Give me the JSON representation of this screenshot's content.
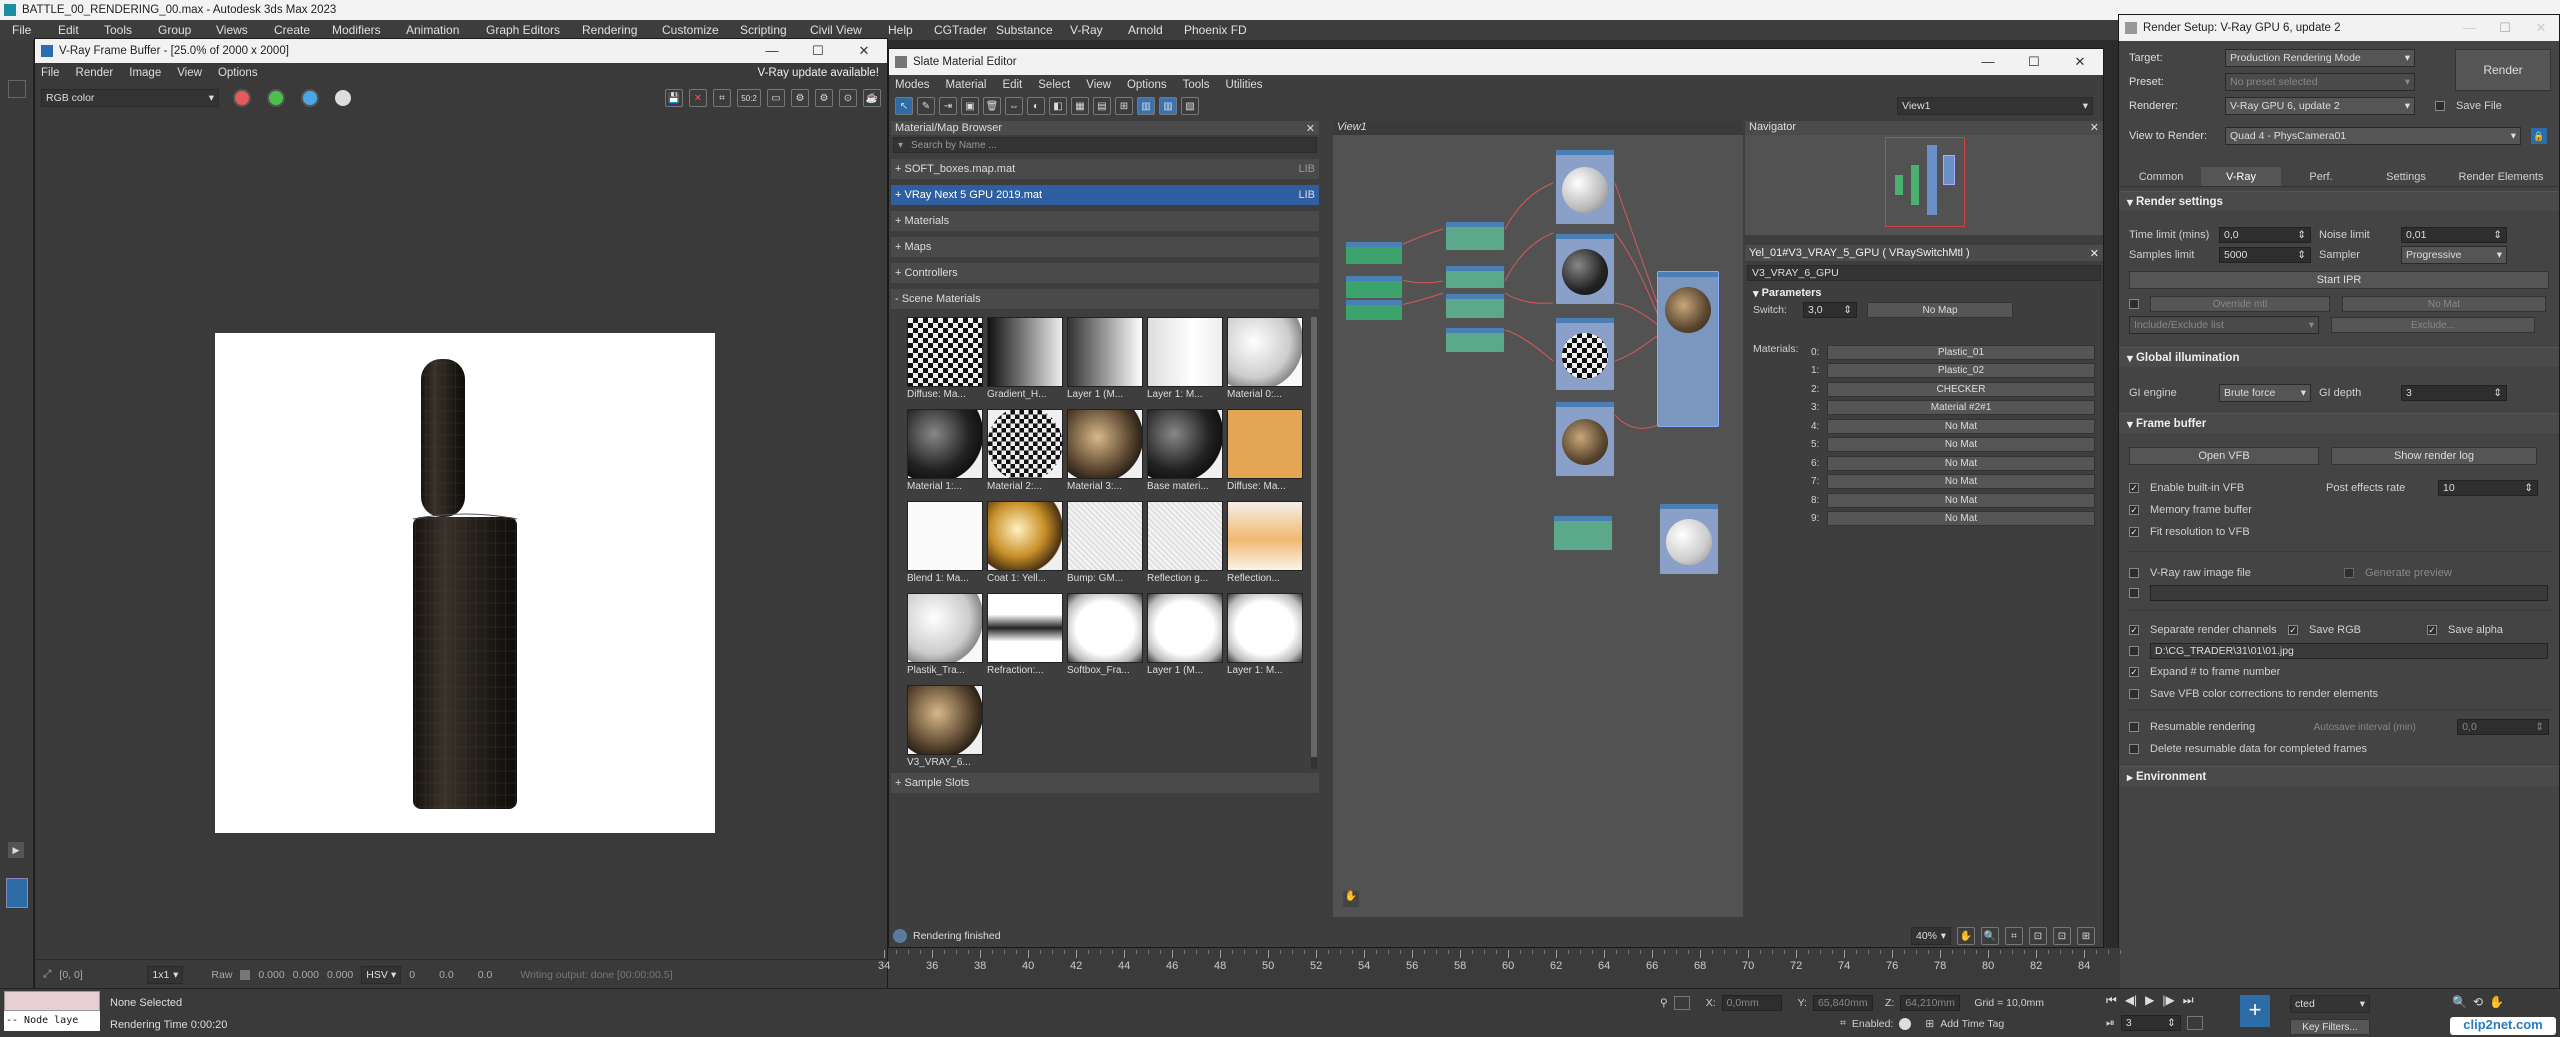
{
  "app": {
    "title": "BATTLE_00_RENDERING_00.max - Autodesk 3ds Max 2023",
    "menu": [
      "File",
      "Edit",
      "Tools",
      "Group",
      "Views",
      "Create",
      "Modifiers",
      "Animation",
      "Graph Editors",
      "Rendering",
      "Customize",
      "Scripting",
      "Civil View",
      "Help",
      "CGTrader",
      "Substance",
      "V-Ray",
      "Arnold",
      "Phoenix FD"
    ]
  },
  "vfb": {
    "title": "V-Ray Frame Buffer - [25.0% of 2000 x 2000]",
    "menu": [
      "File",
      "Render",
      "Image",
      "View",
      "Options"
    ],
    "update": "V-Ray update available!",
    "channel": "RGB color",
    "zoom_label": "50:2",
    "status": {
      "coords": "[0, 0]",
      "ratio": "1x1",
      "raw": "Raw",
      "v1": "0.000",
      "v2": "0.000",
      "v3": "0.000",
      "cs": "HSV",
      "n1": "0",
      "n2": "0.0",
      "n3": "0.0",
      "msg": "Writing output: done [00:00:00.5]"
    },
    "colors": {
      "red": "#e35b5b",
      "green": "#4cc24c",
      "blue": "#4aa8e8"
    }
  },
  "slate": {
    "title": "Slate Material Editor",
    "menu": [
      "Modes",
      "Material",
      "Edit",
      "Select",
      "View",
      "Options",
      "Tools",
      "Utilities"
    ],
    "view_dropdown": "View1",
    "browser_title": "Material/Map Browser",
    "search_placeholder": "Search by Name ...",
    "libs": [
      {
        "name": "+ SOFT_boxes.map.mat",
        "tag": "LIB",
        "active": false
      },
      {
        "name": "+ VRay Next 5 GPU 2019.mat",
        "tag": "LIB",
        "active": true
      }
    ],
    "groups": [
      "+ Materials",
      "+ Maps",
      "+ Controllers",
      "- Scene Materials"
    ],
    "swatches": [
      {
        "label": "Diffuse: Ma...",
        "style": "checker"
      },
      {
        "label": "Gradient_H...",
        "style": "gradh"
      },
      {
        "label": "Layer 1 (M...",
        "style": "gradh2"
      },
      {
        "label": "Layer 1: M...",
        "style": "gradv"
      },
      {
        "label": "Material 0:...",
        "style": "white_sphere"
      },
      {
        "label": "Material 1:...",
        "style": "dark_sphere"
      },
      {
        "label": "Material 2:...",
        "style": "checker_sphere"
      },
      {
        "label": "Material 3:...",
        "style": "brown_sphere"
      },
      {
        "label": "Base materi...",
        "style": "dark_sphere"
      },
      {
        "label": "Diffuse: Ma...",
        "style": "orange"
      },
      {
        "label": "Blend 1: Ma...",
        "style": "white"
      },
      {
        "label": "Coat 1: Yell...",
        "style": "gold_sphere"
      },
      {
        "label": "Bump: GM...",
        "style": "noise"
      },
      {
        "label": "Reflection g...",
        "style": "noise"
      },
      {
        "label": "Reflection...",
        "style": "orange_grad"
      },
      {
        "label": "Plastik_Tra...",
        "style": "white_sphere"
      },
      {
        "label": "Refraction:...",
        "style": "gradv2"
      },
      {
        "label": "Softbox_Fra...",
        "style": "softbox"
      },
      {
        "label": "Layer 1 (M...",
        "style": "softbox"
      },
      {
        "label": "Layer 1: M...",
        "style": "softbox"
      },
      {
        "label": "V3_VRAY_6...",
        "style": "brown_sphere"
      }
    ],
    "sample_slots": "+ Sample Slots",
    "view_tab": "View1",
    "navigator": "Navigator",
    "status": "Rendering finished",
    "zoom": "40%",
    "params": {
      "header": "Yel_01#V3_VRAY_5_GPU  ( VRaySwitchMtl )",
      "name": "V3_VRAY_6_GPU",
      "section": "Parameters",
      "switch_label": "Switch:",
      "switch_val": "3,0",
      "switch_map": "No Map",
      "materials_label": "Materials:",
      "slots": [
        {
          "i": "0:",
          "v": "Plastic_01"
        },
        {
          "i": "1:",
          "v": "Plastic_02"
        },
        {
          "i": "2:",
          "v": "CHECKER"
        },
        {
          "i": "3:",
          "v": "Material #2#1"
        },
        {
          "i": "4:",
          "v": "No Mat"
        },
        {
          "i": "5:",
          "v": "No Mat"
        },
        {
          "i": "6:",
          "v": "No Mat"
        },
        {
          "i": "7:",
          "v": "No Mat"
        },
        {
          "i": "8:",
          "v": "No Mat"
        },
        {
          "i": "9:",
          "v": "No Mat"
        }
      ]
    }
  },
  "render": {
    "title": "Render Setup: V-Ray GPU 6, update 2",
    "target_label": "Target:",
    "target": "Production Rendering Mode",
    "preset_label": "Preset:",
    "preset": "No preset selected",
    "renderer_label": "Renderer:",
    "renderer": "V-Ray GPU 6, update 2",
    "save_file": "Save File",
    "render_btn": "Render",
    "view_label": "View to Render:",
    "view": "Quad 4 - PhysCamera01",
    "tabs": [
      "Common",
      "V-Ray",
      "Perf.",
      "Settings",
      "Render Elements"
    ],
    "rs": "Render settings",
    "time_limit_label": "Time limit (mins)",
    "time_limit": "0,0",
    "noise_label": "Noise limit",
    "noise": "0,01",
    "samples_label": "Samples limit",
    "samples": "5000",
    "sampler_label": "Sampler",
    "sampler": "Progressive",
    "start_ipr": "Start IPR",
    "override": "Override mtl",
    "nomat": "No Mat",
    "include": "Include/Exclude list",
    "exclude": "Exclude...",
    "gi": "Global illumination",
    "gi_engine_label": "GI engine",
    "gi_engine": "Brute force",
    "gi_depth_label": "GI depth",
    "gi_depth": "3",
    "fb": "Frame buffer",
    "open_vfb": "Open VFB",
    "show_log": "Show render log",
    "enable_vfb": "Enable built-in VFB",
    "post_label": "Post effects rate",
    "post": "10",
    "mem_fb": "Memory frame buffer",
    "fit_res": "Fit resolution to VFB",
    "raw_file": "V-Ray raw image file",
    "gen_preview": "Generate preview",
    "sep": "Separate render channels",
    "save_rgb": "Save RGB",
    "save_alpha": "Save alpha",
    "path": "D:\\CG_TRADER\\31\\01\\01.jpg",
    "expand": "Expand # to frame number",
    "save_corr": "Save VFB color corrections to render elements",
    "resumable": "Resumable rendering",
    "autosave_label": "Autosave interval (min)",
    "autosave": "0,0",
    "delete_res": "Delete resumable data for completed frames",
    "env": "Environment"
  },
  "timeline": {
    "ticks": [
      "34",
      "36",
      "38",
      "40",
      "42",
      "44",
      "46",
      "48",
      "50",
      "52",
      "54",
      "56",
      "58",
      "60",
      "62",
      "64",
      "66",
      "68",
      "70",
      "72",
      "74",
      "76",
      "78",
      "80",
      "82",
      "84"
    ]
  },
  "status": {
    "none_selected": "None Selected",
    "render_time": "Rendering Time  0:00:20",
    "node_layer": "-- Node laye",
    "x_label": "X:",
    "x": "0,0mm",
    "y_label": "Y:",
    "y": "65,840mm",
    "z_label": "Z:",
    "z": "64,210mm",
    "grid": "Grid = 10,0mm",
    "enabled": "Enabled:",
    "add_tag": "Add Time Tag",
    "key_filters": "Key Filters...",
    "frame": "3",
    "selected": "cted",
    "watermark": "clip2net.com"
  }
}
